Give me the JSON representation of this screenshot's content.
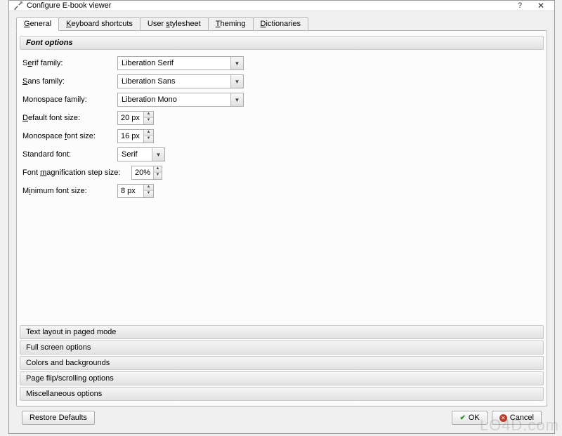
{
  "title": "Configure E-book viewer",
  "tabs": [
    {
      "label": "General",
      "accel": "G",
      "active": true
    },
    {
      "label": "Keyboard shortcuts",
      "accel": "K"
    },
    {
      "label": "User stylesheet",
      "accel": "s"
    },
    {
      "label": "Theming",
      "accel": "T"
    },
    {
      "label": "Dictionaries",
      "accel": "D"
    }
  ],
  "s_font": {
    "header": "Font options",
    "serif_label": "Serif family:",
    "serif_u": "e",
    "serif_val": "Liberation Serif",
    "sans_label": "Sans family:",
    "sans_u": "S",
    "sans_val": "Liberation Sans",
    "mono_label": "Monospace family:",
    "mono_u": "",
    "mono_val": "Liberation Mono",
    "def_label": "Default font size:",
    "def_u": "D",
    "def_val": "20 px",
    "monosz_label": "Monospace font size:",
    "monosz_u": "f",
    "monosz_val": "16 px",
    "std_label": "Standard font:",
    "std_val": "Serif",
    "mag_label": "Font magnification step size:",
    "mag_u": "m",
    "mag_val": "20%",
    "min_label": "Minimum font size:",
    "min_u": "i",
    "min_val": "8 px"
  },
  "collapsed": [
    "Text layout in paged mode",
    "Full screen options",
    "Colors and backgrounds",
    "Page flip/scrolling options",
    "Miscellaneous options"
  ],
  "footer": {
    "restore": "Restore Defaults",
    "ok": "OK",
    "cancel": "Cancel"
  },
  "watermark": "LO4D.com"
}
